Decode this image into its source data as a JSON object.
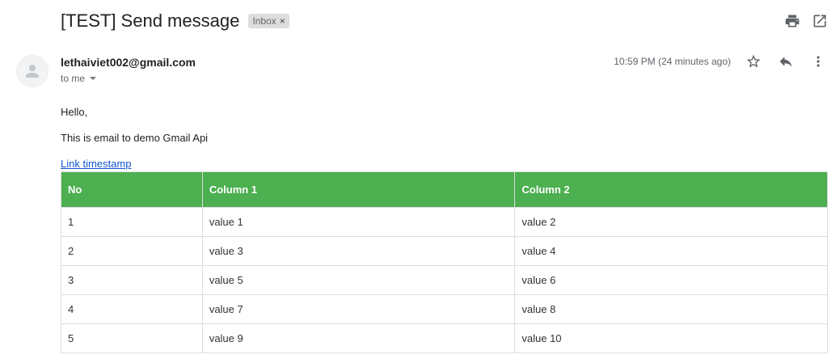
{
  "email": {
    "subject": "[TEST] Send message",
    "label": "Inbox",
    "label_remove": "×",
    "sender": "lethaiviet002@gmail.com",
    "recipient_summary": "to me",
    "timestamp": "10:59 PM (24 minutes ago)",
    "greeting": "Hello,",
    "body_line": "This is email to demo Gmail Api",
    "link_text": "Link timestamp"
  },
  "table": {
    "header_color": "#4caf50",
    "headers": [
      "No",
      "Column 1",
      "Column 2"
    ],
    "rows": [
      [
        "1",
        "value 1",
        "value 2"
      ],
      [
        "2",
        "value 3",
        "value 4"
      ],
      [
        "3",
        "value 5",
        "value 6"
      ],
      [
        "4",
        "value 7",
        "value 8"
      ],
      [
        "5",
        "value 9",
        "value 10"
      ]
    ]
  },
  "icons": {
    "top": [
      "print-icon",
      "open-in-new-window-icon"
    ],
    "message": [
      "star-icon",
      "reply-icon",
      "more-options-icon"
    ],
    "avatar": "default-avatar-icon"
  }
}
